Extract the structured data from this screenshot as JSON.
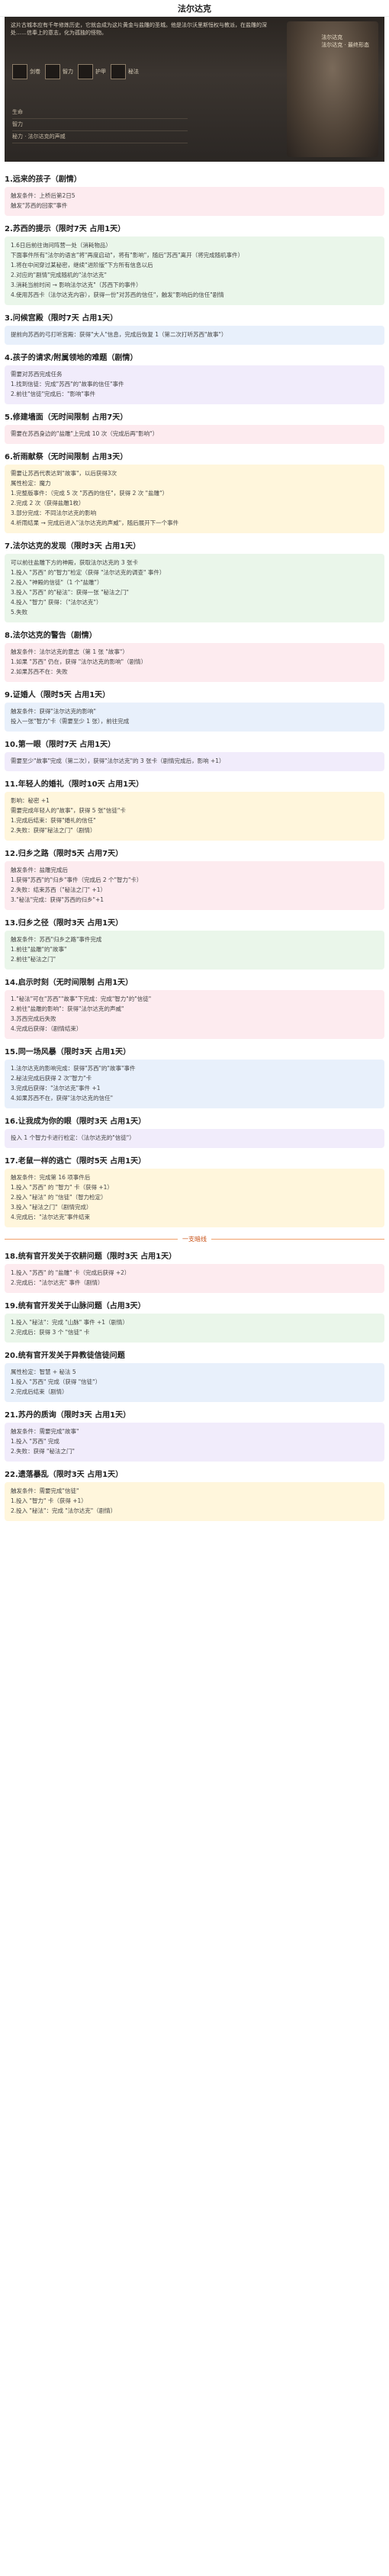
{
  "page_title": "法尔达克",
  "banner": {
    "intro": "这片古城本应有千年修炼历史，它就会成为这片黄金与盐雕的圣城。他是法尔沃里斯恒权与教派，在盐雕的深处……信奉上的意志，化为孤独的怪物。",
    "portrait_tag": "法尔达克\n法尔达克 · 最终形态",
    "slots": [
      "剑卷",
      "智力",
      "护甲",
      "秘法"
    ],
    "stats": [
      "生命",
      "智力",
      "秘力 · 法尔达克的声威"
    ]
  },
  "sections": [
    {
      "title": "1.远来的孩子（剧情）",
      "color": "pink",
      "lines": [
        "触发条件：上桥后第2日5",
        "触发\"苏西的回家\"事件"
      ]
    },
    {
      "title": "2.苏西的提示（限时7天 占用1天）",
      "color": "green",
      "lines": [
        "1.6日后前往询问阵营一处（消耗物品）",
        "下面事件所有\"法尔的语言\"将\"再度启动\"，将有\"影响\"，随后\"苏西\"离开（将完成随机事件）",
        "1.将在中间穿过某秘密，继续\"进阶版\"下方所有信息以后",
        "2.对应的\"剧情\"完成随机的\"法尔达克\"",
        "3.消耗当前时间 → 影响法尔达克\"（苏西下的事件）",
        "4.使用苏西卡（法尔达克内容），获得一份\"对苏西的信任\"，触发\"影响后的信任\"剧情"
      ]
    },
    {
      "title": "3.问候宫殿（限时7天 占用1天）",
      "color": "blue",
      "lines": [
        "提前向苏西的弓打听宫殿：获得\"大人\"信息，完成后恢复 1（第二次打听苏西\"故事\"）"
      ]
    },
    {
      "title": "4.孩子的请求/附属领地的难题（剧情）",
      "color": "purple",
      "lines": [
        "需要对苏西完成任务",
        "1.找到信徒：完成\"苏西\"的\"故事的信任\"事件",
        "2.前往\"信徒\"完成后：\"影响\"事件"
      ]
    },
    {
      "title": "5.修建墙面（无时间限制 占用7天）",
      "color": "pink",
      "lines": [
        "需要在苏西身边的\"盐雕\"上完成 10 次（完成后再\"影响\"）"
      ]
    },
    {
      "title": "6.祈雨献祭（无时间限制 占用3天）",
      "color": "yellow",
      "lines": [
        "需要让苏西代表达到\"故事\"，以后获得3次",
        "属性检定：魔力",
        "1.完整版事件：（完成 5 次 \"苏西的信任\"，获得 2 次 \"盐雕\"）",
        "2.完成 2 次（获得盐雕1枚）",
        "3.部分完成：不同法尔达克的影响",
        "4.祈雨结果 → 完成后进入\"法尔达克的声威\"，随后展开下一个事件"
      ]
    },
    {
      "title": "7.法尔达克的发现（限时3天 占用1天）",
      "color": "green",
      "lines": [
        "可以前往盐雕下方的神殿，获取法尔达克的 3 张卡",
        "1.投入 \"苏西\" 的\"智力\"检定（获得 \"法尔达克的调查\" 事件）",
        "2.投入 \"神殿的信徒\"（1 个\"盐雕\"）",
        "3.投入 \"苏西\" 的\"秘法\"：获得一张 \"秘法之门\"",
        "4.投入 \"智力\" 获得：（\"法尔达克\"）",
        "5.失败"
      ]
    },
    {
      "title": "8.法尔达克的警告（剧情）",
      "color": "pink",
      "lines": [
        "触发条件：法尔达克的意志（第 1 张 \"故事\"）",
        "1.如果 \"苏西\" 仍在，获得 \"法尔达克的影响\"（剧情）",
        "2.如果苏西不在：失败"
      ]
    },
    {
      "title": "9.证婚人（限时5天 占用1天）",
      "color": "blue",
      "lines": [
        "触发条件：获得\"法尔达克的影响\"",
        "投入一张\"智力\"卡（需要至少 1 张），前往完成"
      ]
    },
    {
      "title": "10.第一眼（限时7天 占用1天）",
      "color": "purple",
      "lines": [
        "需要至少\"故事\"完成（第二次），获得\"法尔达克\"的 3 张卡（剧情完成后，影响 +1）"
      ]
    },
    {
      "title": "11.年轻人的婚礼（限时10天 占用1天）",
      "color": "yellow",
      "lines": [
        "影响：秘密 +1",
        "需要完成年轻人的\"故事\"，获得 5 张\"信徒\"卡",
        "1.完成后结束：获得\"婚礼的信任\"",
        "2.失败：获得\"秘法之门\"（剧情）"
      ]
    },
    {
      "title": "12.归乡之路（限时5天 占用7天）",
      "color": "pink",
      "lines": [
        "触发条件：盐雕完成后",
        "1.获得\"苏西\"的\"归乡\"事件（完成后 2 个\"智力\"卡）",
        "2.失败：结束苏西（\"秘法之门\" +1）",
        "3.\"秘法\"完成：获得\"苏西的归乡\"+1"
      ]
    },
    {
      "title": "13.归乡之径（限时3天 占用1天）",
      "color": "green",
      "lines": [
        "触发条件：苏西\"归乡之路\"事件完成",
        "1.前往\"盐雕\"的\"故事\"",
        "2.前往\"秘法之门\""
      ]
    },
    {
      "title": "14.启示时刻（无时间限制 占用1天）",
      "color": "pink",
      "lines": [
        "1.\"秘法\"可在\"苏西\"\"故事\"下完成：完成\"智力\"的\"信徒\"",
        "2.前往\"盐雕的影响\"：获得\"法尔达克的声威\"",
        "3.苏西完成后失败",
        "4.完成后获得：（剧情结束）"
      ]
    },
    {
      "title": "15.同一场风暴（限时3天 占用1天）",
      "color": "blue",
      "lines": [
        "1.法尔达克的影响完成：获得\"苏西\"的\"故事\"事件",
        "2.秘法完成后获得 2 次\"智力\"卡",
        "3.完成后获得：\"法尔达克\"事件 +1",
        "4.如果苏西不在，获得\"法尔达克的信任\""
      ]
    },
    {
      "title": "16.让我成为你的眼（限时3天 占用1天）",
      "color": "purple",
      "lines": [
        "投入 1 个智力卡进行检定：（法尔达克的\"信徒\"）"
      ]
    },
    {
      "title": "17.老鼠一样的逃亡（限时5天 占用1天）",
      "color": "yellow",
      "lines": [
        "触发条件：完成第 16 项事件后",
        "1.投入 \"苏西\" 的 \"智力\" 卡（获得 +1）",
        "2.投入 \"秘法\" 的 \"信徒\"（智力检定）",
        "3.投入 \"秘法之门\"（剧情完成）",
        "4.完成后：\"法尔达克\"事件结束"
      ]
    },
    {
      "title": "18.统有官开发关于农耕问题（限时3天 占用1天）",
      "color": "pink",
      "lines": [
        "1.投入 \"苏西\" 的 \"盐雕\" 卡（完成后获得 +2）",
        "2.完成后：\"法尔达克\" 事件（剧情）"
      ]
    },
    {
      "title": "19.统有官开发关于山脉问题（占用3天）",
      "color": "green",
      "lines": [
        "1.投入 \"秘法\"：完成 \"山脉\" 事件 +1（剧情）",
        "2.完成后：获得 3 个 \"信徒\" 卡"
      ]
    },
    {
      "title": "20.统有官开发关于异教徒信徒问题",
      "color": "blue",
      "lines": [
        "属性检定：智慧 + 秘法 5",
        "1.投入 \"苏西\" 完成（获得 \"信徒\"）",
        "2.完成后结束（剧情）"
      ]
    },
    {
      "title": "21.苏丹的质询（限时3天 占用1天）",
      "color": "purple",
      "lines": [
        "触发条件：需要完成\"故事\"",
        "1.投入 \"苏西\" 完成",
        "2.失败：获得 \"秘法之门\""
      ]
    },
    {
      "title": "22.遗落暴乱（限时3天 占用1天）",
      "color": "yellow",
      "lines": [
        "触发条件：需要完成\"信徒\"",
        "1.投入 \"智力\" 卡（获得 +1）",
        "2.投入 \"秘法\"：完成 \"法尔达克\"（剧情）"
      ]
    }
  ],
  "divider_label": "一支暗线"
}
